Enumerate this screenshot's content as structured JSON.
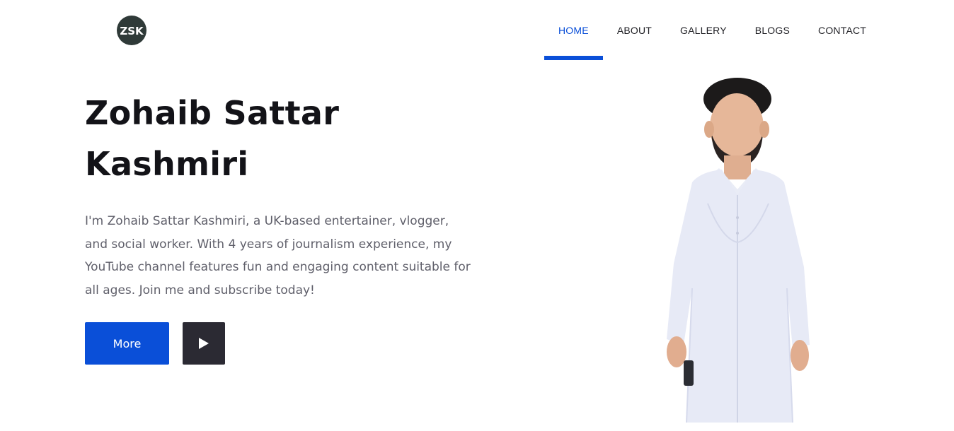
{
  "header": {
    "logo_text": "ZSK",
    "nav": [
      {
        "label": "HOME",
        "active": true
      },
      {
        "label": "ABOUT",
        "active": false
      },
      {
        "label": "GALLERY",
        "active": false
      },
      {
        "label": "BLOGS",
        "active": false
      },
      {
        "label": "CONTACT",
        "active": false
      }
    ]
  },
  "hero": {
    "title_line1": "Zohaib Sattar",
    "title_line2": "Kashmiri",
    "description": "I'm Zohaib Sattar Kashmiri, a UK-based entertainer, vlogger, and social worker. With 4 years of journalism experience, my YouTube channel features fun and engaging content suitable for all ages. Join me and subscribe today!",
    "more_label": "More",
    "play_icon": "play-icon"
  },
  "colors": {
    "accent": "#0a4fd8",
    "dark_button": "#2b2a33",
    "heading": "#131318",
    "body_text": "#5f5f6a"
  }
}
